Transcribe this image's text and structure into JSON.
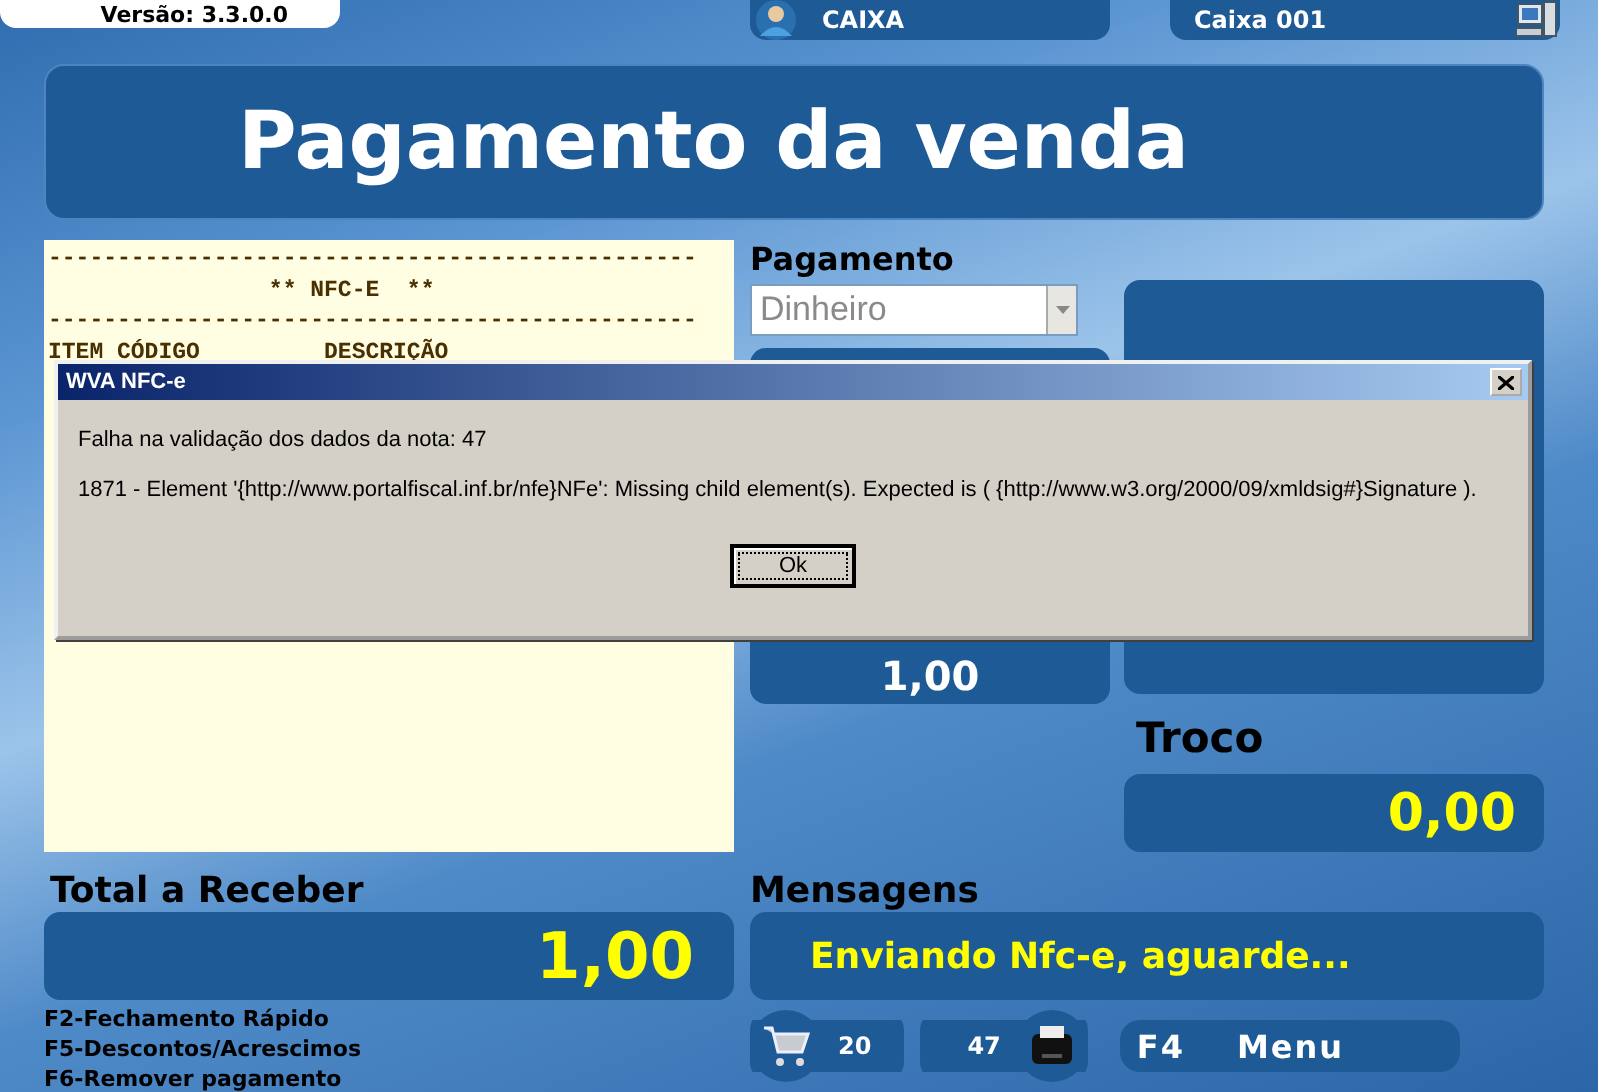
{
  "header": {
    "version": "Versão: 3.3.0.0",
    "user": "CAIXA",
    "terminal": "Caixa 001"
  },
  "title": "Pagamento da venda",
  "receipt": {
    "lines": [
      "-----------------------------------------------",
      "                ** NFC-E  **",
      "-----------------------------------------------",
      "ITEM CÓDIGO         DESCRIÇÃO"
    ]
  },
  "payment": {
    "label": "Pagamento",
    "method": "Dinheiro",
    "disabled": true,
    "amount": "1,00"
  },
  "change": {
    "label": "Troco",
    "value": "0,00"
  },
  "total": {
    "label": "Total a Receber",
    "value": "1,00"
  },
  "messages": {
    "label": "Mensagens",
    "text": "Enviando Nfc-e, aguarde..."
  },
  "shortcuts": [
    "F2-Fechamento Rápido",
    "F5-Descontos/Acrescimos",
    "F6-Remover pagamento"
  ],
  "status": {
    "items": "20",
    "notes": "47",
    "menu_key": "F4",
    "menu_label": "Menu"
  },
  "dialog": {
    "title": "WVA NFC-e",
    "message": "Falha na validação dos dados da nota: 47",
    "detail": "1871 - Element '{http://www.portalfiscal.inf.br/nfe}NFe': Missing child element(s). Expected is ( {http://www.w3.org/2000/09/xmldsig#}Signature ).",
    "button": "Ok"
  }
}
